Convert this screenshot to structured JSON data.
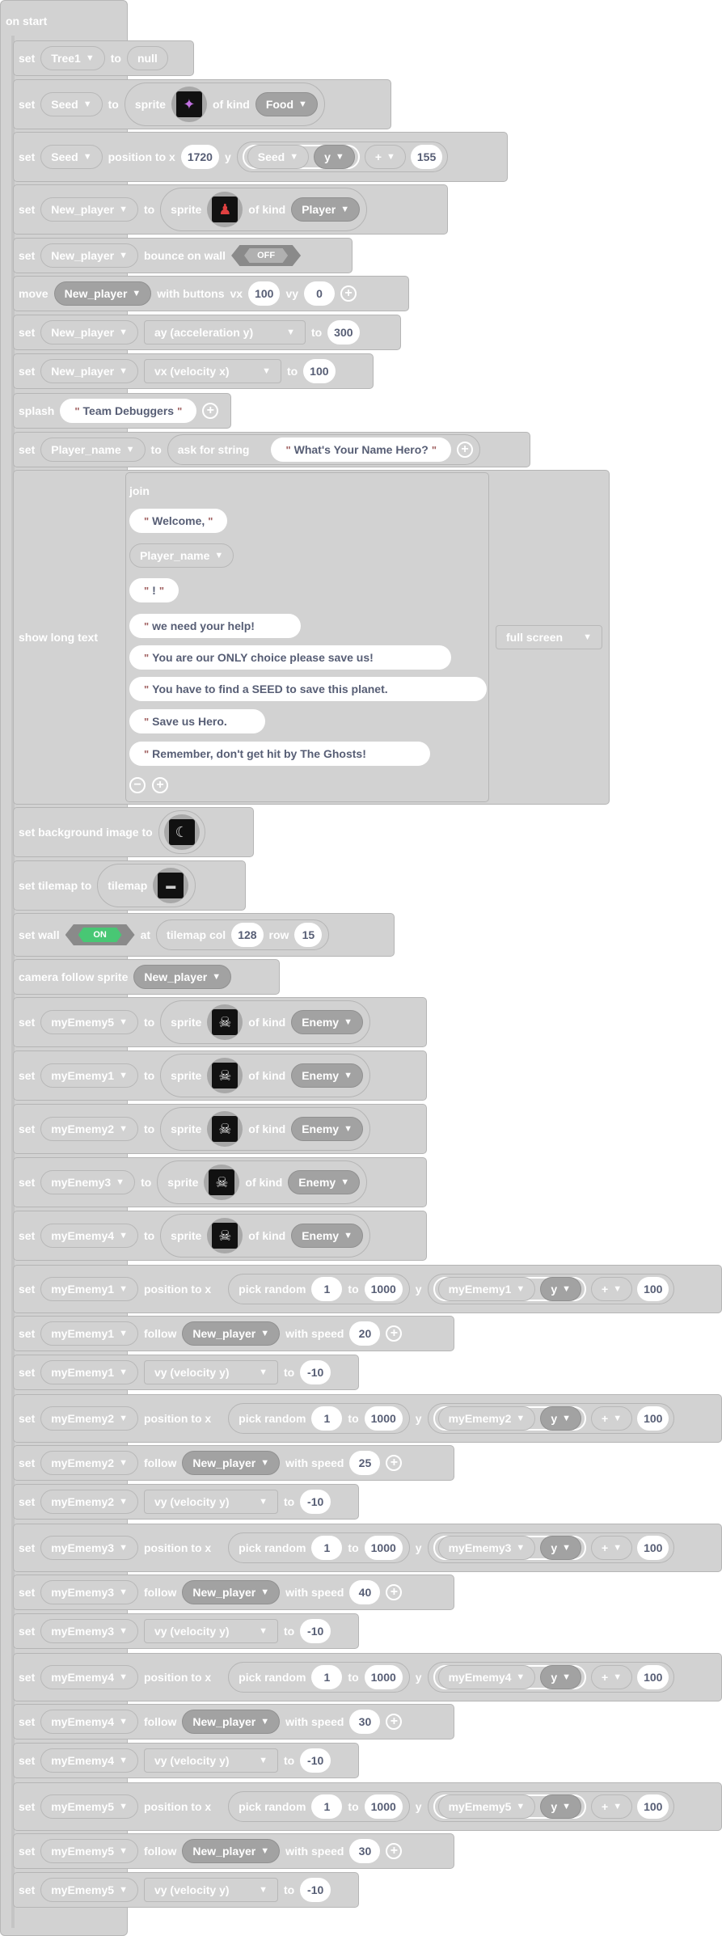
{
  "hat": {
    "label": "on start"
  },
  "kw": {
    "set": "set",
    "to": "to",
    "sprite": "sprite",
    "of_kind": "of kind",
    "position_to_x": "position to x",
    "y": "y",
    "move": "move",
    "with_buttons": "with buttons",
    "vx": "vx",
    "vy": "vy",
    "bounce_on_wall": "bounce on wall",
    "splash": "splash",
    "ask_for_string": "ask for string",
    "show_long_text": "show long text",
    "join": "join",
    "set_bg": "set background image to",
    "set_tilemap": "set tilemap to",
    "tilemap": "tilemap",
    "set_wall": "set wall",
    "at": "at",
    "tilemap_col": "tilemap col",
    "row": "row",
    "camera_follow": "camera follow sprite",
    "follow": "follow",
    "with_speed": "with speed",
    "pick_random": "pick random"
  },
  "blocks": {
    "tree_var": "Tree1",
    "null": "null",
    "seed_var": "Seed",
    "food_kind": "Food",
    "seed_x": "1720",
    "seed_prop": "y",
    "seed_op": "+",
    "seed_add": "155",
    "player_var": "New_player",
    "player_kind": "Player",
    "off": "OFF",
    "on": "ON",
    "move_vx": "100",
    "move_vy": "0",
    "ay": "ay (acceleration y)",
    "ay_val": "300",
    "vx": "vx (velocity x)",
    "vx_val": "100",
    "splash_text": "Team Debuggers",
    "name_var": "Player_name",
    "ask_text": "What's Your Name Hero?",
    "full_screen": "full screen",
    "tile_col": "128",
    "tile_row": "15",
    "vy_prop": "vy (velocity y)",
    "vy_val": "-10",
    "rand_min": "1",
    "rand_max": "1000",
    "y_add": "100",
    "op_plus": "+",
    "y_prop": "y"
  },
  "join_items": [
    {
      "type": "str",
      "text": "Welcome,"
    },
    {
      "type": "var",
      "text": "Player_name"
    },
    {
      "type": "str",
      "text": "!"
    },
    {
      "type": "str",
      "text": "we need your help!"
    },
    {
      "type": "str",
      "text": "You are our ONLY choice please save us!"
    },
    {
      "type": "str",
      "text": "You have to find a SEED to save this planet."
    },
    {
      "type": "str",
      "text": "Save us Hero."
    },
    {
      "type": "str",
      "text": "Remember, don't get hit by The Ghosts!"
    }
  ],
  "enemy_kind": "Enemy",
  "enemies": [
    {
      "set": "myEmemy5",
      "pos": "myEmemy1",
      "speed": "20"
    },
    {
      "set": "myEmemy1",
      "pos": "myEmemy2",
      "speed": "25"
    },
    {
      "set": "myEmemy2",
      "pos": "myEmemy3",
      "speed": "40"
    },
    {
      "set": "myEnemy3",
      "pos": "myEmemy4",
      "speed": "30"
    },
    {
      "set": "myEmemy4",
      "pos": "myEmemy5",
      "speed": "30"
    }
  ],
  "icons": {
    "seed": "seed-sprite-icon",
    "player": "player-sprite-icon",
    "enemy": "ghost-sprite-icon",
    "bg": "moon-image-icon",
    "tilemap": "tilemap-thumb-icon"
  }
}
